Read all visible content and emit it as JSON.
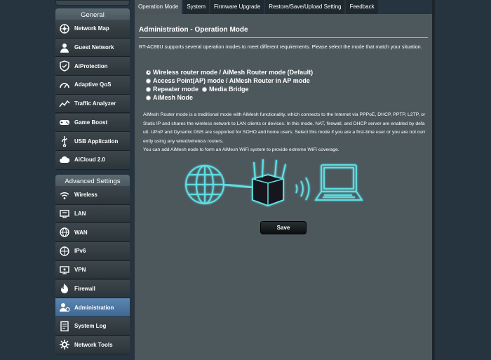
{
  "sidebar": {
    "general_header": "General",
    "general_items": [
      {
        "label": "Network Map",
        "icon": "network-map-icon"
      },
      {
        "label": "Guest Network",
        "icon": "guest-network-icon"
      },
      {
        "label": "AiProtection",
        "icon": "aiprotection-icon"
      },
      {
        "label": "Adaptive QoS",
        "icon": "adaptive-qos-icon"
      },
      {
        "label": "Traffic Analyzer",
        "icon": "traffic-analyzer-icon"
      },
      {
        "label": "Game Boost",
        "icon": "game-boost-icon"
      },
      {
        "label": "USB Application",
        "icon": "usb-icon"
      },
      {
        "label": "AiCloud 2.0",
        "icon": "cloud-icon"
      }
    ],
    "advanced_header": "Advanced Settings",
    "advanced_items": [
      {
        "label": "Wireless",
        "icon": "wireless-icon"
      },
      {
        "label": "LAN",
        "icon": "lan-icon"
      },
      {
        "label": "WAN",
        "icon": "wan-icon"
      },
      {
        "label": "IPv6",
        "icon": "ipv6-icon"
      },
      {
        "label": "VPN",
        "icon": "vpn-icon"
      },
      {
        "label": "Firewall",
        "icon": "firewall-icon"
      },
      {
        "label": "Administration",
        "icon": "administration-icon",
        "active": true
      },
      {
        "label": "System Log",
        "icon": "system-log-icon"
      },
      {
        "label": "Network Tools",
        "icon": "network-tools-icon"
      }
    ]
  },
  "tabs": [
    {
      "label": "Operation Mode",
      "active": true
    },
    {
      "label": "System"
    },
    {
      "label": "Firmware Upgrade"
    },
    {
      "label": "Restore/Save/Upload Setting"
    },
    {
      "label": "Feedback"
    }
  ],
  "main": {
    "title": "Administration - Operation Mode",
    "description": "RT-AC86U supports several operation modes to meet different requirements. Please select the mode that match your situation.",
    "modes": {
      "wireless_router": "Wireless router mode / AiMesh Router mode (Default)",
      "access_point": "Access Point(AP) mode / AiMesh Router in AP mode",
      "repeater": "Repeater mode",
      "media_bridge": "Media Bridge",
      "aimesh_node": "AiMesh Node",
      "selected": "wireless_router"
    },
    "info_lines": [
      "AiMesh Router mode is a traditional mode with AiMesh functionality, which connects to the Internet via PPPoE, DHCP, PPTP, L2TP, or",
      "Static IP and shares the wireless network to LAN clients or devices. In this mode, NAT, firewall, and DHCP server are enabled by defa",
      "ult. UPnP and Dynamic DNS are supported for SOHO and home users. Select this mode if you are a first-time user or you are not curr",
      "ently using any wired/wireless routers.",
      "You can add AiMesh node to form an AiMesh WiFi system to provide extreme WiFi coverage."
    ],
    "save_label": "Save"
  },
  "colors": {
    "background": "#263440",
    "panel": "#4d585d",
    "accent_line": "#7eb4e6",
    "active_item": "#4f79a6",
    "diagram_glow": "#5fe3e8"
  }
}
